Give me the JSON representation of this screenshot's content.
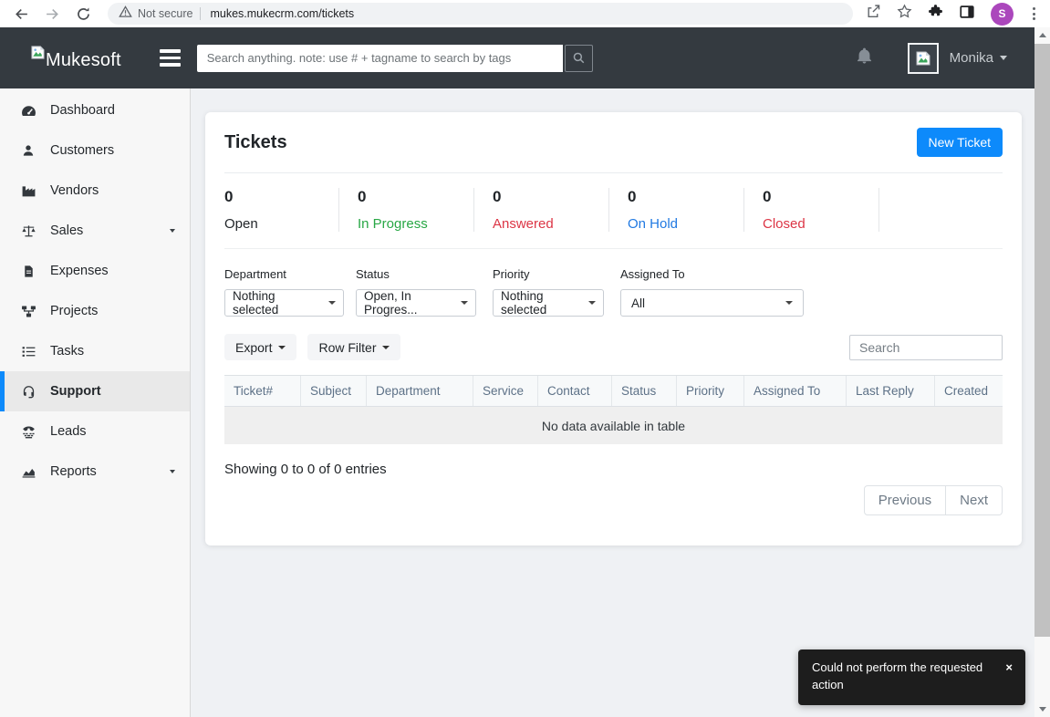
{
  "browser": {
    "security_label": "Not secure",
    "url": "mukes.mukecrm.com/tickets",
    "profile_initial": "S",
    "icons": [
      "back-icon",
      "forward-icon",
      "reload-icon",
      "warning-icon",
      "share-icon",
      "star-icon",
      "extensions-icon",
      "side-panel-icon",
      "menu-kebab-icon"
    ]
  },
  "app_header": {
    "brand": "Mukesoft",
    "search_placeholder": "Search anything. note: use # + tagname to search by tags",
    "user_name": "Monika",
    "icons": [
      "broken-image-icon",
      "hamburger-icon",
      "search-icon",
      "bell-icon",
      "avatar-broken-image-icon",
      "caret-down-icon"
    ]
  },
  "sidebar": {
    "items": [
      {
        "label": "Dashboard",
        "icon": "dashboard-icon",
        "active": false,
        "has_caret": false
      },
      {
        "label": "Customers",
        "icon": "customers-icon",
        "active": false,
        "has_caret": false
      },
      {
        "label": "Vendors",
        "icon": "vendors-icon",
        "active": false,
        "has_caret": false
      },
      {
        "label": "Sales",
        "icon": "sales-icon",
        "active": false,
        "has_caret": true
      },
      {
        "label": "Expenses",
        "icon": "expenses-icon",
        "active": false,
        "has_caret": false
      },
      {
        "label": "Projects",
        "icon": "projects-icon",
        "active": false,
        "has_caret": false
      },
      {
        "label": "Tasks",
        "icon": "tasks-icon",
        "active": false,
        "has_caret": false
      },
      {
        "label": "Support",
        "icon": "support-icon",
        "active": true,
        "has_caret": false
      },
      {
        "label": "Leads",
        "icon": "leads-icon",
        "active": false,
        "has_caret": false
      },
      {
        "label": "Reports",
        "icon": "reports-icon",
        "active": false,
        "has_caret": true
      }
    ]
  },
  "tickets": {
    "title": "Tickets",
    "new_ticket_label": "New Ticket",
    "stats": [
      {
        "value": "0",
        "label": "Open",
        "color": "#212529"
      },
      {
        "value": "0",
        "label": "In Progress",
        "color": "#28a745"
      },
      {
        "value": "0",
        "label": "Answered",
        "color": "#dc3545"
      },
      {
        "value": "0",
        "label": "On Hold",
        "color": "#2079e2"
      },
      {
        "value": "0",
        "label": "Closed",
        "color": "#dc3545"
      }
    ],
    "filters": [
      {
        "label": "Department",
        "value": "Nothing selected"
      },
      {
        "label": "Status",
        "value": "Open, In Progres..."
      },
      {
        "label": "Priority",
        "value": "Nothing selected"
      },
      {
        "label": "Assigned To",
        "value": "All"
      }
    ],
    "toolbar": {
      "export_label": "Export",
      "row_filter_label": "Row Filter",
      "search_placeholder": "Search"
    },
    "table": {
      "headers": [
        "Ticket#",
        "Subject",
        "Department",
        "Service",
        "Contact",
        "Status",
        "Priority",
        "Assigned To",
        "Last Reply",
        "Created"
      ],
      "empty_message": "No data available in table"
    },
    "summary": "Showing 0 to 0 of 0 entries",
    "pagination": {
      "previous": "Previous",
      "next": "Next"
    }
  },
  "toast": {
    "message": "Could not perform the requested action",
    "close": "×"
  },
  "colors": {
    "accent_blue": "#0d8afb",
    "header_dark": "#343a40",
    "sidebar_bg": "#f7f7f7",
    "page_bg": "#eff1f4",
    "success_green": "#28a745",
    "danger_red": "#dc3545",
    "info_blue": "#2079e2",
    "chrome_profile_purple": "#ab47bc",
    "toast_dark": "#1d1d1d"
  }
}
